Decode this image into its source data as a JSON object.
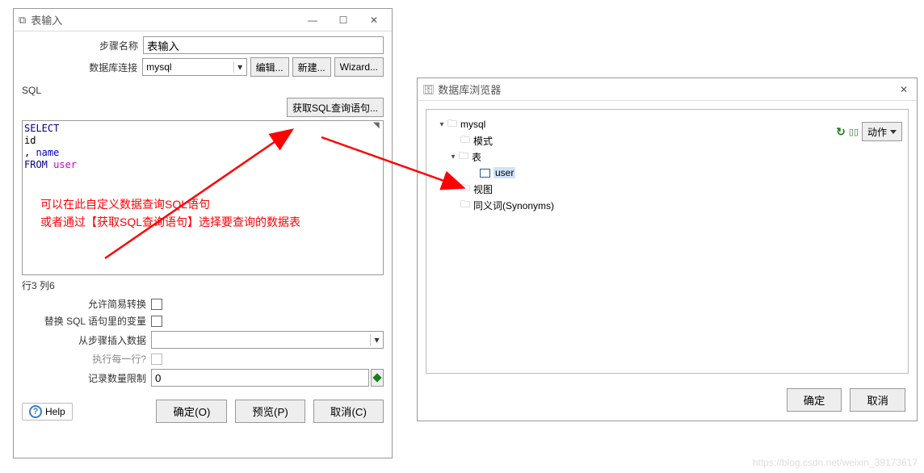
{
  "left": {
    "title": "表输入",
    "minimize": "—",
    "maximize": "☐",
    "close": "✕",
    "step_label": "步骤名称",
    "step_value": "表输入",
    "conn_label": "数据库连接",
    "conn_value": "mysql",
    "btn_edit": "编辑...",
    "btn_new": "新建...",
    "btn_wizard": "Wizard...",
    "sql_label": "SQL",
    "btn_get_sql": "获取SQL查询语句...",
    "sql": {
      "l1a": "SELECT",
      "l2": "  id",
      "l3a": ", ",
      "l3b": "name",
      "l4a": "FROM ",
      "l4b": "user"
    },
    "note_line1": "可以在此自定义数据查询SQL语句",
    "note_line2": "或者通过【获取SQL查询语句】选择要查询的数据表",
    "status": "行3 列6",
    "opt_simple": "允许简易转换",
    "opt_replace_var": "替换 SQL 语句里的变量",
    "opt_from_step": "从步骤插入数据",
    "opt_exec_each": "执行每一行?",
    "opt_limit": "记录数量限制",
    "limit_value": "0",
    "help": "Help",
    "ok": "确定(O)",
    "preview": "预览(P)",
    "cancel": "取消(C)"
  },
  "right": {
    "title": "数据库浏览器",
    "close": "✕",
    "action": "动作",
    "tree": {
      "root": "mysql",
      "schema": "模式",
      "tables": "表",
      "user_table": "user",
      "views": "视图",
      "synonyms": "同义词(Synonyms)"
    },
    "ok": "确定",
    "cancel": "取消"
  },
  "watermark": "https://blog.csdn.net/weixin_39173617"
}
